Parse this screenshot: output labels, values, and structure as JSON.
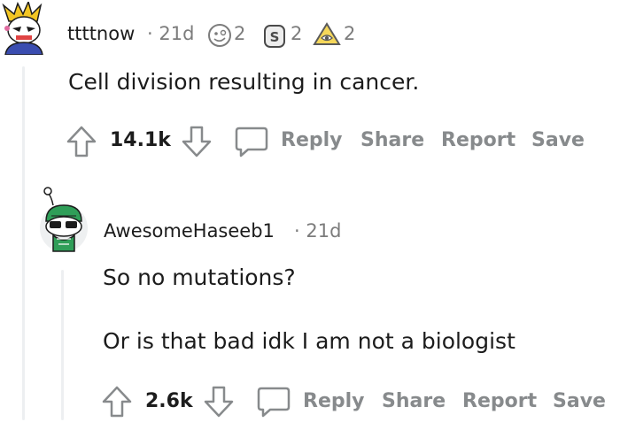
{
  "comment1": {
    "username": "ttttnow",
    "time": "· 21d",
    "awards": [
      {
        "icon": "silly-face-award-icon",
        "count": "2"
      },
      {
        "icon": "silver-s-award-icon",
        "count": "2"
      },
      {
        "icon": "pyramid-eye-award-icon",
        "count": "2"
      }
    ],
    "body": "Cell division resulting in cancer.",
    "score": "14.1k",
    "actions": {
      "reply": "Reply",
      "share": "Share",
      "report": "Report",
      "save": "Save"
    }
  },
  "comment2": {
    "username": "AwesomeHaseeb1",
    "time": "· 21d",
    "body_lines": [
      "So no mutations?",
      "Or is that bad idk I am not a biologist"
    ],
    "score": "2.6k",
    "actions": {
      "reply": "Reply",
      "share": "Share",
      "report": "Report",
      "save": "Save"
    }
  },
  "colors": {
    "upvote_outline": "#878a8c",
    "thread_line": "#edeff1",
    "text": "#1c1c1c",
    "muted": "#7c7c7c"
  }
}
